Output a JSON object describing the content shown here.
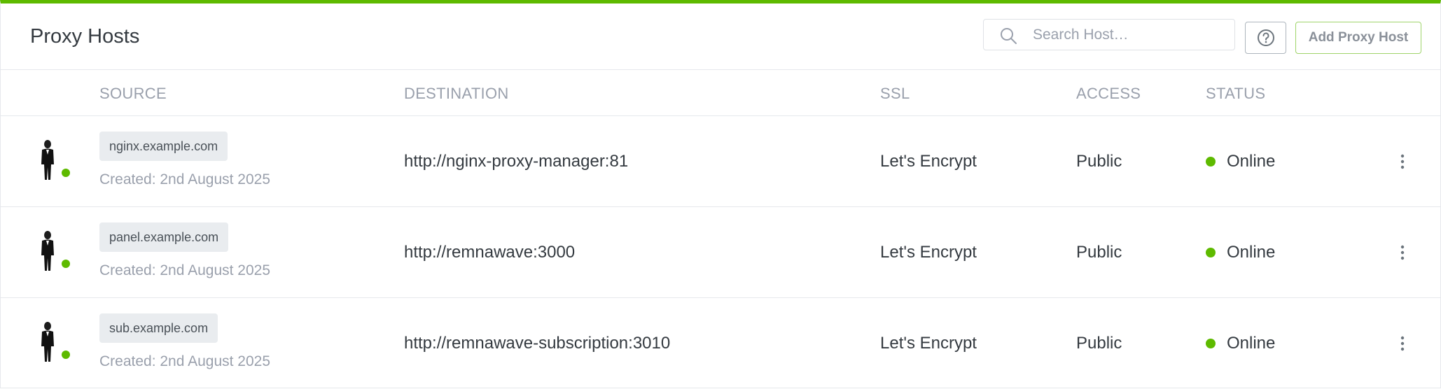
{
  "header": {
    "title": "Proxy Hosts",
    "search_placeholder": "Search Host…",
    "help_icon": "help-circle-icon",
    "add_button_label": "Add Proxy Host"
  },
  "table": {
    "columns": [
      "SOURCE",
      "DESTINATION",
      "SSL",
      "ACCESS",
      "STATUS"
    ],
    "rows": [
      {
        "domain": "nginx.example.com",
        "created": "Created: 2nd August 2025",
        "destination": "http://nginx-proxy-manager:81",
        "ssl": "Let's Encrypt",
        "access": "Public",
        "status": "Online"
      },
      {
        "domain": "panel.example.com",
        "created": "Created: 2nd August 2025",
        "destination": "http://remnawave:3000",
        "ssl": "Let's Encrypt",
        "access": "Public",
        "status": "Online"
      },
      {
        "domain": "sub.example.com",
        "created": "Created: 2nd August 2025",
        "destination": "http://remnawave-subscription:3010",
        "ssl": "Let's Encrypt",
        "access": "Public",
        "status": "Online"
      }
    ]
  },
  "colors": {
    "accent": "#5eba00",
    "status_online": "#5eba00",
    "muted_text": "#9aa0ac"
  }
}
